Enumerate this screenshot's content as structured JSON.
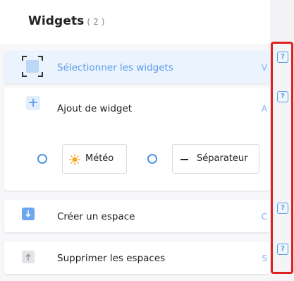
{
  "header": {
    "title": "Widgets",
    "count": "( 2 )"
  },
  "rows": [
    {
      "label": "Sélectionner les widgets",
      "shortcut": "V",
      "icon": "selection-icon"
    },
    {
      "label": "Ajout de widget",
      "shortcut": "A",
      "icon": "plus-icon"
    },
    {
      "label": "Créer un espace",
      "shortcut": "C",
      "icon": "arrow-down-icon"
    },
    {
      "label": "Supprimer les espaces",
      "shortcut": "S",
      "icon": "arrow-up-icon"
    }
  ],
  "widget_options": [
    {
      "label": "Météo",
      "icon": "sun-icon"
    },
    {
      "label": "Séparateur",
      "icon": "dash-icon"
    }
  ],
  "help_label": "?",
  "colors": {
    "accent": "#4f93e5",
    "selected_bg": "#eaf3fe",
    "highlight_box": "#e02020"
  }
}
